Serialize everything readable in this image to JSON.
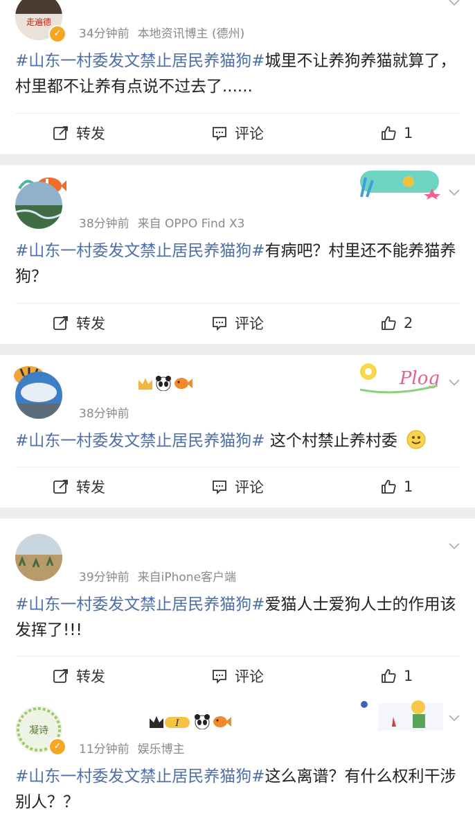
{
  "hashtag": "#山东一村委发文禁止居民养猫狗#",
  "actions": {
    "repost": "转发",
    "comment": "评论"
  },
  "posts": [
    {
      "time": "34分钟前",
      "source": "本地资讯博主 (德州)",
      "text": "城里不让养狗养猫就算了，村里都不让养有点说不过去了......",
      "likes": "1",
      "avatar_text": "走遍德"
    },
    {
      "time": "38分钟前",
      "source": "来自 OPPO Find X3",
      "text": "有病吧？村里还不能养猫养狗？",
      "likes": "2"
    },
    {
      "time": "38分钟前",
      "source": "",
      "text": " 这个村禁止养村委",
      "likes": "1",
      "decor_text": "Plog"
    },
    {
      "time": "39分钟前",
      "source": "来自iPhone客户端",
      "text": "爱猫人士爱狗人士的作用该发挥了!!!",
      "likes": "1"
    },
    {
      "time": "11分钟前",
      "source": "娱乐博主",
      "text": "这么离谱？有什么权利干涉别人？？",
      "avatar_text": "凝诗"
    }
  ],
  "colors": {
    "hashtag": "#4e6fa8",
    "meta": "#8a8a8a",
    "separator": "#ededed",
    "vip_badge": "#f5a623"
  },
  "icons": [
    "chevron-down-icon",
    "repost-icon",
    "comment-icon",
    "like-icon",
    "verified-icon",
    "smiley-emoji-icon",
    "panda-icon",
    "fish-icon",
    "crown-icon"
  ]
}
